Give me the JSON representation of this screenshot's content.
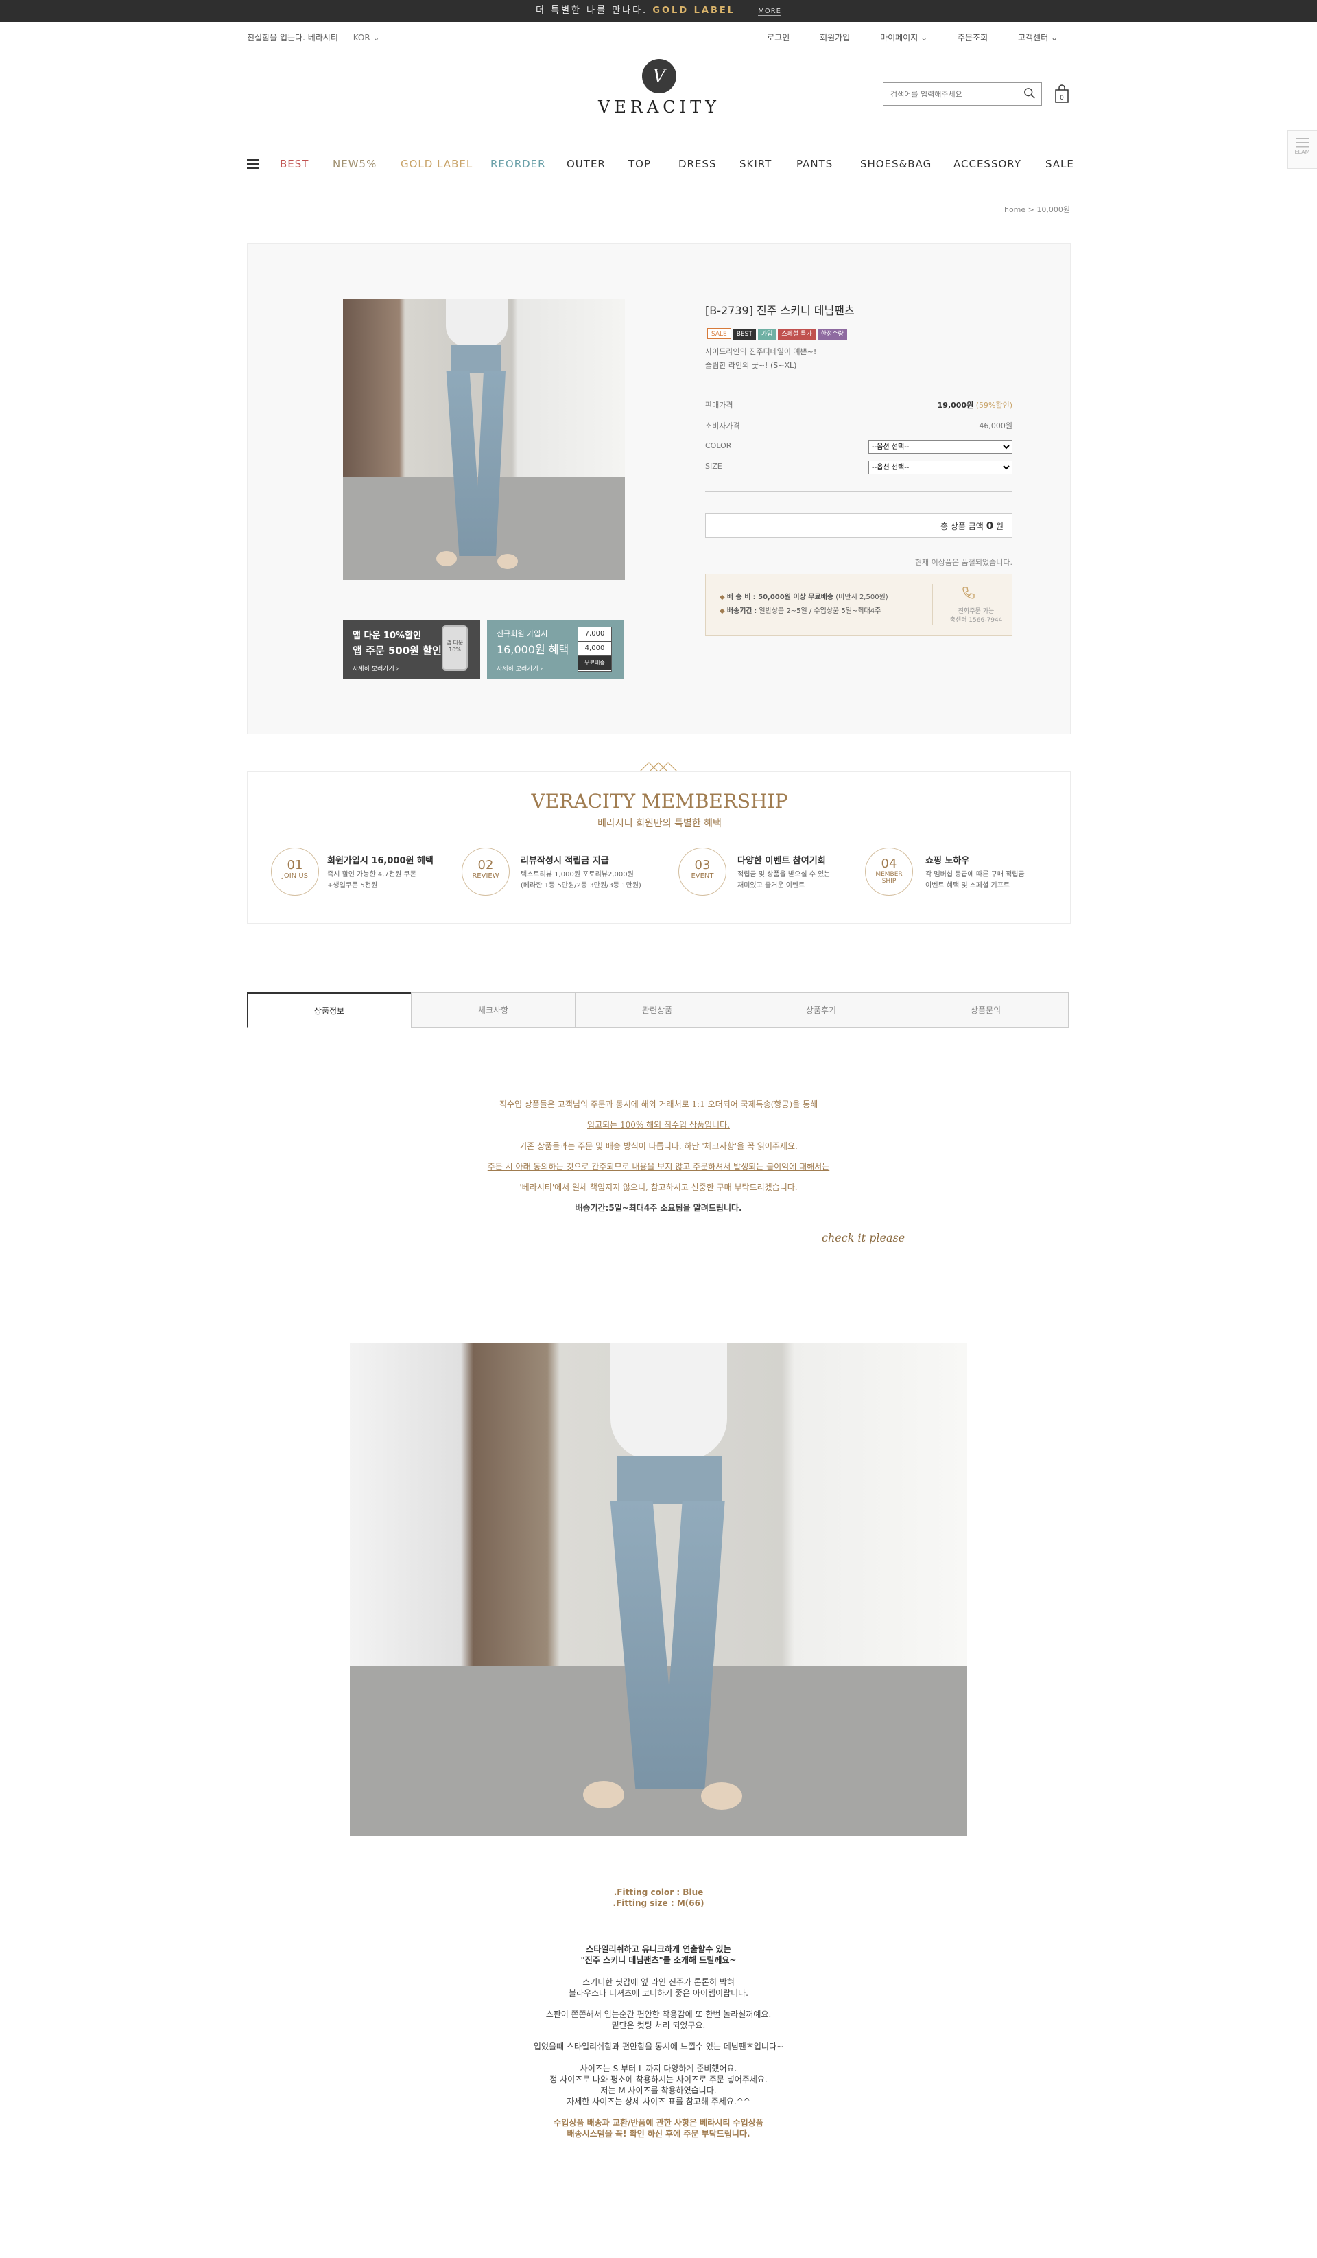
{
  "topbar": {
    "text": "더 특별한 나를 만나다.",
    "gold": "GOLD LABEL",
    "more": "MORE"
  },
  "util": {
    "slogan": "진실함을 입는다. 베라시티",
    "lang": "KOR ⌄",
    "login": "로그인",
    "join": "회원가입",
    "mypage": "마이페이지 ⌄",
    "order": "주문조회",
    "cs": "고객센터 ⌄"
  },
  "logo": {
    "mark": "V",
    "name": "VERACITY"
  },
  "search": {
    "placeholder": "검색어를 입력해주세요"
  },
  "cart": {
    "count": "0"
  },
  "gnb": {
    "best": "BEST",
    "new": "NEW5%",
    "gold": "GOLD LABEL",
    "reorder": "REORDER",
    "outer": "OUTER",
    "top": "TOP",
    "dress": "DRESS",
    "skirt": "SKIRT",
    "pants": "PANTS",
    "shoesbag": "SHOES&BAG",
    "accessory": "ACCESSORY",
    "sale": "SALE"
  },
  "side": {
    "label": "ELAM"
  },
  "breadcrumb": {
    "home": "home",
    "sep": ">",
    "current": "10,000원"
  },
  "product": {
    "title": "[B-2739] 진주 스키니 데님팬츠",
    "badges": [
      "SALE",
      "BEST",
      "가입",
      "스페셜 특가",
      "한정수량"
    ],
    "desc1": "사이드라인의 진주디테일이 예쁜~!",
    "desc2": "슬림한 라인의 굿~! (S~XL)",
    "price_label": "판매가격",
    "price": "19,000원",
    "discount": "(59%할인)",
    "consumer_label": "소비자가격",
    "consumer_price": "46,000원",
    "color_label": "COLOR",
    "size_label": "SIZE",
    "option_default": "--옵션 선택--",
    "total_label": "총 상품 금액",
    "total_value": "0",
    "total_unit": "원",
    "soldout": "현재 이상품은 품절되었습니다.",
    "ship_fee_label": "배 송 비",
    "ship_fee": ": 50,000원 이상 무료배송",
    "ship_fee_note": "(미만시 2,500원)",
    "ship_time_label": "배송기간",
    "ship_time": ": 일반상품 2~5일 / 수입상품 5일~최대4주",
    "phone_line1": "전화주문 가능",
    "phone_line2": "총센터 1566-7944"
  },
  "banners": {
    "app": {
      "line1": "앱 다운 10%할인",
      "line2": "앱 주문 500원 할인",
      "link": "자세히 보러가기 ›",
      "phone_text": "앱 다운 10%"
    },
    "newmember": {
      "line1": "신규회원 가입시",
      "line2": "16,000원 혜택",
      "link": "자세히 보러가기 ›",
      "c1": "7,000",
      "c2": "4,000",
      "c3": "무료배송"
    }
  },
  "membership": {
    "title": "VERACITY MEMBERSHIP",
    "subtitle": "베라시티 회원만의 특별한 혜택",
    "items": [
      {
        "num": "01",
        "tag": "JOIN US",
        "title": "회원가입시 16,000원 혜택",
        "d1": "즉시 할인 가능한 4,7천원 쿠폰",
        "d2": "+생일쿠폰 5천원"
      },
      {
        "num": "02",
        "tag": "REVIEW",
        "title": "리뷰작성시 적립금 지급",
        "d1": "텍스트리뷰 1,000원 포토리뷰2,000원",
        "d2": "(베라한 1등 5만원/2등 3만원/3등 1만원)"
      },
      {
        "num": "03",
        "tag": "EVENT",
        "title": "다양한 이벤트 참여기회",
        "d1": "적립금 및 상품을 받으실 수 있는",
        "d2": "재미있고 즐거운 이벤트"
      },
      {
        "num": "04",
        "tag": "MEMBER SHIP",
        "title": "쇼핑 노하우",
        "d1": "각 멤버십 등급에 따른 구매 적립금",
        "d2": "이벤트 혜택 및 스페셜 기프트"
      }
    ]
  },
  "tabs": [
    "상품정보",
    "체크사항",
    "관련상품",
    "상품후기",
    "상품문의"
  ],
  "notice": {
    "l1": "직수입 상품들은 고객님의 주문과 동시에 해외 거래처로 1:1 오더되어 국제특송(항공)을 통해",
    "l2": "입고되는 100% 해외 직수입 상품입니다.",
    "l3": "기존 상품들과는 주문 및 배송 방식이 다릅니다. 하단 '체크사항'을 꼭 읽어주세요.",
    "l4": "주문 시 아래 동의하는 것으로 간주되므로 내용을 보지 않고 주문하셔서 발생되는 불이익에 대해서는",
    "l5": "'베라시티'에서 일체 책임지지 않으니, 참고하시고 신중한 구매 부탁드리겠습니다.",
    "l6": "배송기간:5일~최대4주 소요됨을 알려드립니다.",
    "check": "check it please"
  },
  "fitting": {
    "color": ".Fitting color : Blue",
    "size": ".Fitting size : M(66)"
  },
  "detail": {
    "h1": "스타일리쉬하고 유니크하게 연출할수 있는",
    "h2": "\"진주 스키니 데님팬츠\"를 소개해 드릴께요~",
    "p1": "스키니한 핏감에 옆 라인 진주가 톤톤히 박혀",
    "p2": "블라우스나 티셔츠에 코디하기 좋은 아이템이랍니다.",
    "p3": "스판이 쫀쫀해서 입는순간 편안한 착용감에 또 한번 놀라실꺼예요.",
    "p4": "밑단은 컷팅 처리 되었구요.",
    "p5": "입었을때 스타일리쉬함과 편안함을 동시에 느낄수 있는 데님팬츠입니다~",
    "p6": "사이즈는 S 부터 L 까지 다양하게 준비했어요.",
    "p7": "정 사이즈로 나와 평소에 착용하시는 사이즈로 주문 넣어주세요.",
    "p8": "저는 M 사이즈를 착용하였습니다.",
    "p9": "자세한 사이즈는 상세 사이즈 표를 참고해 주세요.^^",
    "n1": "수입상품 배송과 교환/반품에 관한 사항은 베라시티 수입상품",
    "n2": "배송시스템을 꼭! 확인 하신 후에 주문 부탁드립니다."
  },
  "colors": {
    "accent": "#a07c50",
    "best": "#c0514f",
    "new": "#a09070",
    "gold": "#c9a46a",
    "reorder": "#6aa0a8",
    "dark": "#2f2f2f"
  }
}
